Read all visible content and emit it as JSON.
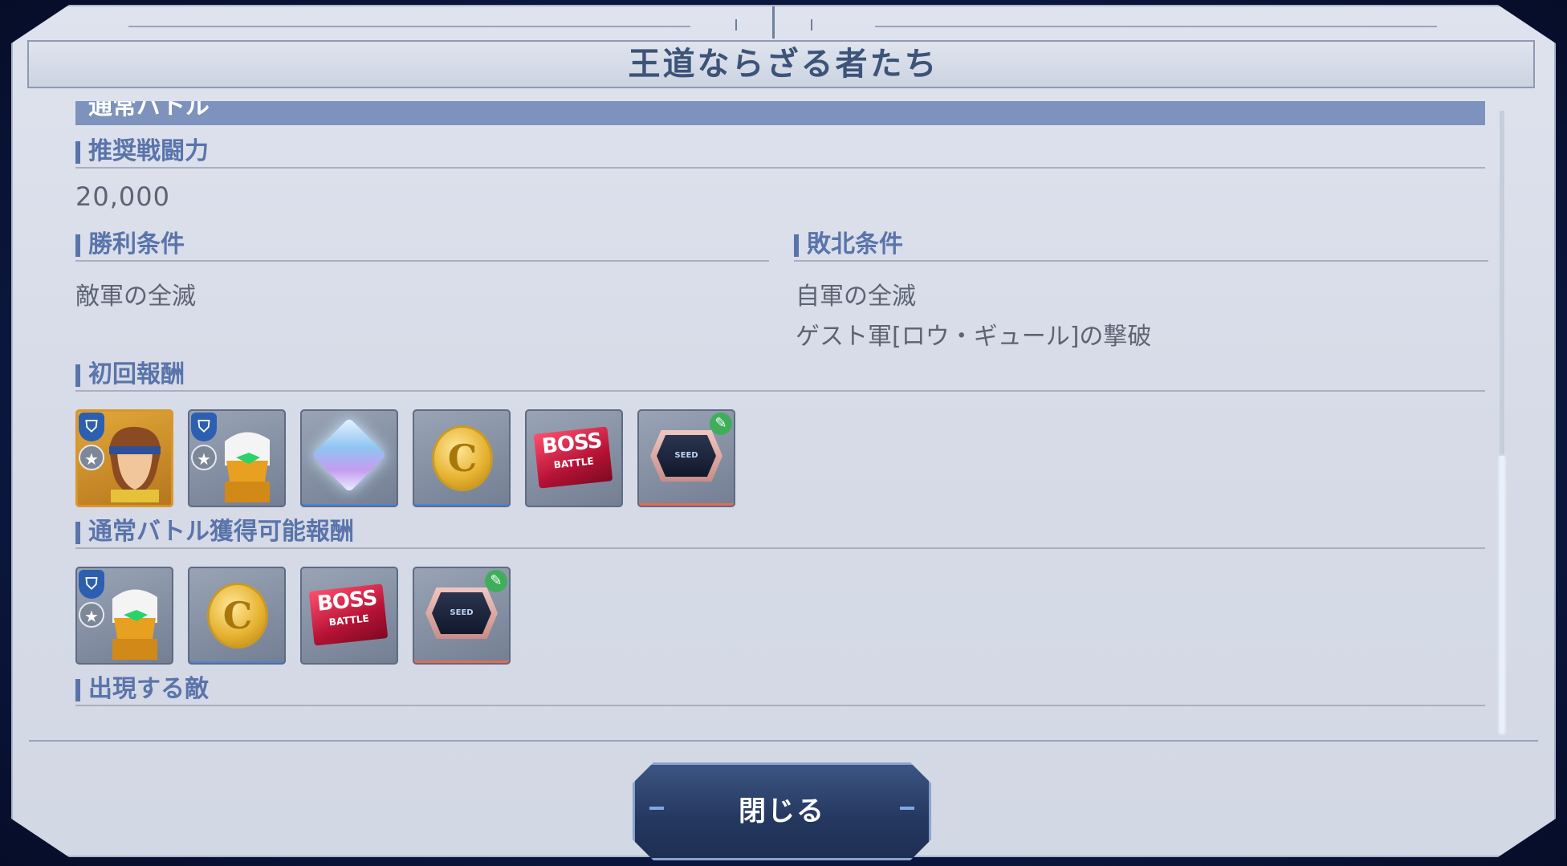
{
  "dialog": {
    "title": "王道ならざる者たち",
    "category": "通常バトル"
  },
  "recommended_power": {
    "label": "推奨戦闘力",
    "value": "20,000"
  },
  "victory": {
    "label": "勝利条件",
    "conditions": [
      "敵軍の全滅"
    ]
  },
  "defeat": {
    "label": "敗北条件",
    "conditions": [
      "自軍の全滅",
      "ゲスト軍[ロウ・ギュール]の撃破"
    ]
  },
  "first_reward": {
    "label": "初回報酬",
    "items": [
      {
        "icon": "pilot-character-icon"
      },
      {
        "icon": "robot-unit-icon"
      },
      {
        "icon": "diamond-gem-icon"
      },
      {
        "icon": "c-coin-icon",
        "text": "C"
      },
      {
        "icon": "boss-battle-ticket-icon",
        "text": "BOSS",
        "subtext": "BATTLE"
      },
      {
        "icon": "gundam-seed-emblem-icon"
      }
    ]
  },
  "normal_reward": {
    "label": "通常バトル獲得可能報酬",
    "items": [
      {
        "icon": "robot-unit-icon"
      },
      {
        "icon": "c-coin-icon",
        "text": "C"
      },
      {
        "icon": "boss-battle-ticket-icon",
        "text": "BOSS",
        "subtext": "BATTLE"
      },
      {
        "icon": "gundam-seed-emblem-icon"
      }
    ]
  },
  "enemies": {
    "label": "出現する敵"
  },
  "buttons": {
    "close": "閉じる"
  },
  "colors": {
    "section_label": "#5a74ab",
    "category_bar": "#7d92bc",
    "title": "#3d5378",
    "button_bg": "#24375e"
  }
}
